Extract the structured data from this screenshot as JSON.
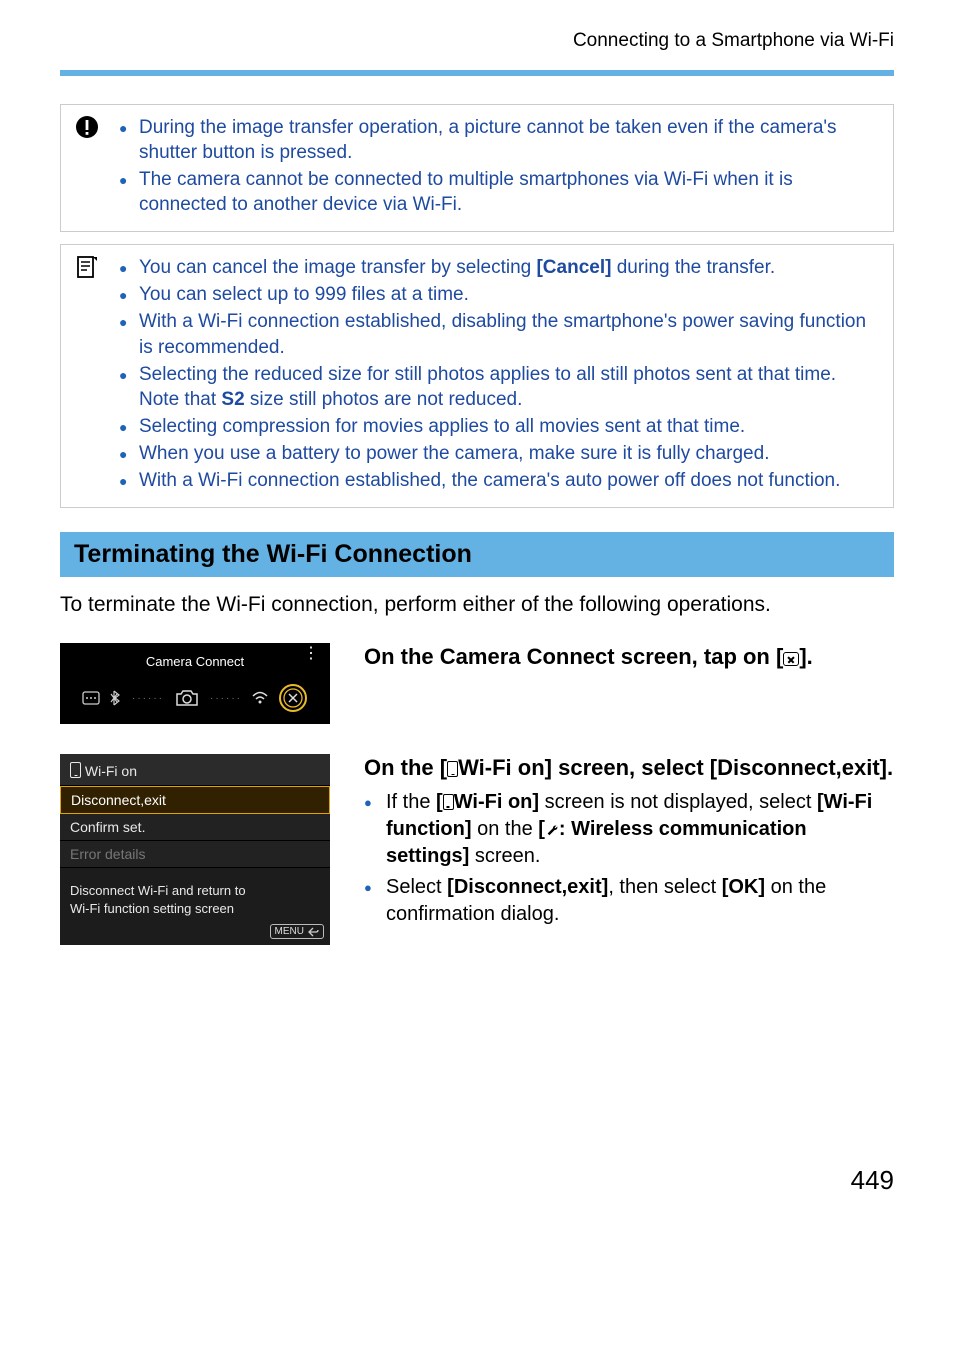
{
  "header": {
    "chapter": "Connecting to a Smartphone via Wi-Fi"
  },
  "warning": {
    "items": [
      "During the image transfer operation, a picture cannot be taken even if the camera's shutter button is pressed.",
      "The camera cannot be connected to multiple smartphones via Wi-Fi when it is connected to another device via Wi-Fi."
    ]
  },
  "note": {
    "items": [
      {
        "pre": "You can cancel the image transfer by selecting ",
        "kw": "[Cancel]",
        "post": " during the transfer."
      },
      {
        "pre": "You can select up to 999 files at a time."
      },
      {
        "pre": "With a Wi-Fi connection established, disabling the smartphone's power saving function is recommended."
      },
      {
        "pre": "Selecting the reduced size for still photos applies to all still photos sent at that time. Note that ",
        "s2": "S2",
        "post": " size still photos are not reduced."
      },
      {
        "pre": "Selecting compression for movies applies to all movies sent at that time."
      },
      {
        "pre": "When you use a battery to power the camera, make sure it is fully charged."
      },
      {
        "pre": "With a Wi-Fi connection established, the camera's auto power off does not function."
      }
    ]
  },
  "section": {
    "title": "Terminating the Wi-Fi Connection"
  },
  "intro": "To terminate the Wi-Fi connection, perform either of the following operations.",
  "step1": {
    "fig_title": "Camera Connect",
    "heading_pre": "On the Camera Connect screen, tap on [",
    "heading_post": "]."
  },
  "step2": {
    "fig_title_pre": "Wi-Fi on",
    "menu_items": [
      {
        "label": "Disconnect,exit",
        "state": "selected"
      },
      {
        "label": "Confirm set.",
        "state": "normal"
      },
      {
        "label": "Error details",
        "state": "disabled"
      }
    ],
    "fig_desc1": "Disconnect Wi-Fi and return to",
    "fig_desc2": "Wi-Fi function setting screen",
    "menu_badge": "MENU",
    "heading_pre": "On the [",
    "heading_mid": "Wi-Fi on] screen, select [Disconnect,exit].",
    "b1_pre": "If the ",
    "b1_kw1_pre": "[",
    "b1_kw1_post": "Wi-Fi on]",
    "b1_mid": " screen is not displayed, select ",
    "b1_kw2": "[Wi-Fi function]",
    "b1_mid2": " on the ",
    "b1_kw3_pre": "[",
    "b1_kw3_post": ": Wireless communication settings]",
    "b1_post": " screen.",
    "b2_pre": "Select ",
    "b2_kw1": "[Disconnect,exit]",
    "b2_mid": ", then select ",
    "b2_kw2": "[OK]",
    "b2_post": " on the confirmation dialog."
  },
  "page_number": "449"
}
